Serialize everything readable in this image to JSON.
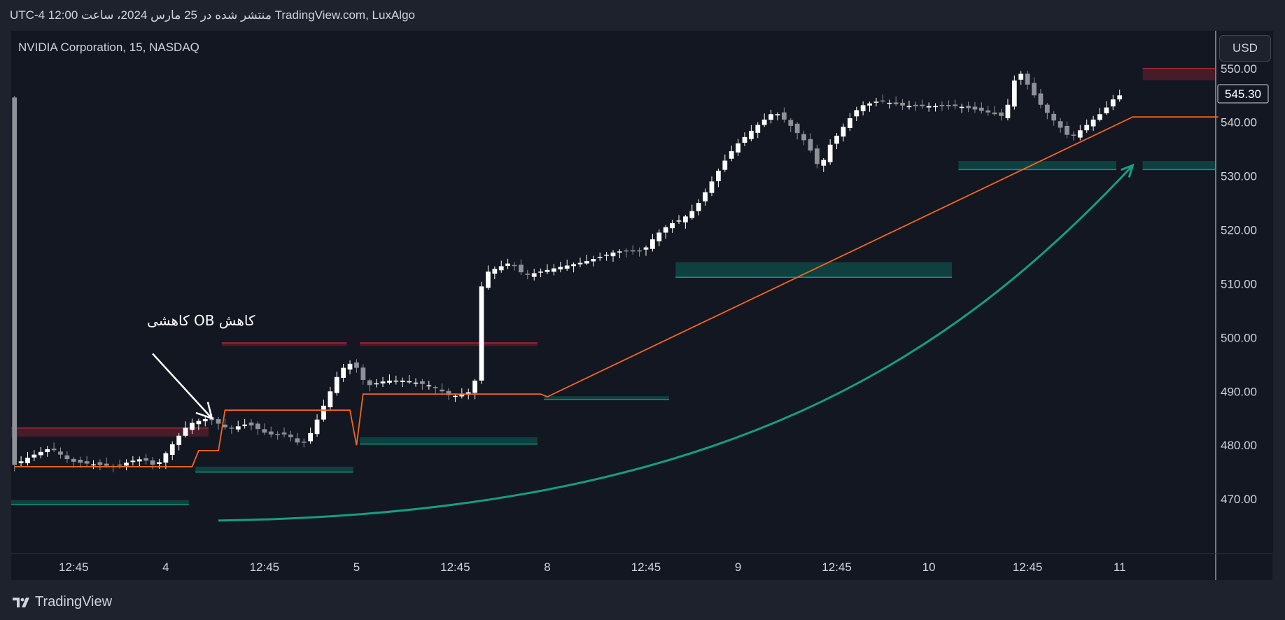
{
  "header": {
    "published_line": "UTC-4 12:00 منتشر شده در 25 مارس 2024، ساعت TradingView.com, LuxAlgo",
    "symbol_label": "NVIDIA Corporation, 15, NASDAQ",
    "currency_label": "USD"
  },
  "annotation": {
    "text": "کاهش OB کاهشی"
  },
  "brand": {
    "name": "TradingView",
    "logo_icon": "tradingview-logo-icon"
  },
  "colors": {
    "background": "#131722",
    "frame": "#1e222d",
    "bull_candle": "#ffffff",
    "bear_candle": "#8f9199",
    "bear_ob": "#b22833",
    "bull_ob": "#089981",
    "orange_line": "#f7651c",
    "arrow_white": "#ffffff",
    "curve_green": "#149e82"
  },
  "chart_data": {
    "type": "candlestick",
    "title": "NVIDIA Corporation, 15, NASDAQ",
    "ylim": [
      460,
      557
    ],
    "y_ticks": [
      "550.00",
      "540.00",
      "530.00",
      "520.00",
      "510.00",
      "500.00",
      "490.00",
      "480.00",
      "470.00"
    ],
    "y_tick_values": [
      550,
      540,
      530,
      520,
      510,
      500,
      490,
      480,
      470
    ],
    "last_price": "545.30",
    "last_price_value": 545.3,
    "x_ticks": [
      "12:45",
      "4",
      "12:45",
      "5",
      "12:45",
      "8",
      "12:45",
      "9",
      "12:45",
      "10",
      "12:45",
      "11"
    ],
    "x_tick_bars": [
      9,
      23,
      38,
      52,
      67,
      81,
      96,
      110,
      125,
      139,
      154,
      168
    ],
    "bars_total": 183,
    "pivots": [
      [
        0,
        476
      ],
      [
        3,
        478
      ],
      [
        6,
        479.5
      ],
      [
        9,
        477
      ],
      [
        12,
        476.5
      ],
      [
        16,
        476
      ],
      [
        18,
        477
      ],
      [
        20,
        477.5
      ],
      [
        22,
        476
      ],
      [
        25,
        481
      ],
      [
        27,
        484
      ],
      [
        30,
        485
      ],
      [
        33,
        483
      ],
      [
        36,
        484
      ],
      [
        39,
        482
      ],
      [
        42,
        482
      ],
      [
        44,
        480
      ],
      [
        45,
        481
      ],
      [
        47,
        486
      ],
      [
        50,
        494
      ],
      [
        52,
        495.5
      ],
      [
        54,
        491
      ],
      [
        57,
        492
      ],
      [
        60,
        492
      ],
      [
        64,
        491
      ],
      [
        67,
        489
      ],
      [
        70,
        490
      ],
      [
        70.5,
        492
      ],
      [
        71,
        507
      ],
      [
        72,
        512
      ],
      [
        76,
        514
      ],
      [
        78,
        511.5
      ],
      [
        83,
        513
      ],
      [
        87,
        514
      ],
      [
        92,
        516
      ],
      [
        96,
        516
      ],
      [
        98,
        519
      ],
      [
        100,
        521
      ],
      [
        102,
        522
      ],
      [
        104,
        524
      ],
      [
        106,
        528
      ],
      [
        108,
        532
      ],
      [
        110,
        535.5
      ],
      [
        113,
        539
      ],
      [
        116,
        542
      ],
      [
        118,
        540
      ],
      [
        121,
        536
      ],
      [
        123,
        531
      ],
      [
        124,
        535
      ],
      [
        127,
        540
      ],
      [
        129,
        543
      ],
      [
        132,
        544
      ],
      [
        136,
        543
      ],
      [
        140,
        543
      ],
      [
        144,
        543
      ],
      [
        148,
        542
      ],
      [
        151,
        541
      ],
      [
        153,
        550
      ],
      [
        156,
        544
      ],
      [
        158,
        541
      ],
      [
        161,
        537
      ],
      [
        164,
        540
      ],
      [
        166,
        542
      ],
      [
        168,
        545
      ]
    ],
    "order_blocks": [
      {
        "kind": "bearish",
        "from_bar": 0,
        "to_bar": 30,
        "top": 483.2,
        "bottom": 481.6
      },
      {
        "kind": "bearish",
        "from_bar": 32,
        "to_bar": 51,
        "top": 499.0,
        "bottom": 498.4
      },
      {
        "kind": "bearish",
        "from_bar": 53,
        "to_bar": 80,
        "top": 499.0,
        "bottom": 498.4
      },
      {
        "kind": "bearish",
        "from_bar": 172,
        "to_bar": 183,
        "top": 550.0,
        "bottom": 547.8
      },
      {
        "kind": "bullish",
        "from_bar": 0,
        "to_bar": 27,
        "top": 469.8,
        "bottom": 469.0
      },
      {
        "kind": "bullish",
        "from_bar": 28,
        "to_bar": 52,
        "top": 476.0,
        "bottom": 475.0
      },
      {
        "kind": "bullish",
        "from_bar": 53,
        "to_bar": 80,
        "top": 481.5,
        "bottom": 480.2
      },
      {
        "kind": "bullish",
        "from_bar": 81,
        "to_bar": 100,
        "top": 489.1,
        "bottom": 488.5
      },
      {
        "kind": "bullish",
        "from_bar": 101,
        "to_bar": 143,
        "top": 514.0,
        "bottom": 511.2
      },
      {
        "kind": "bullish",
        "from_bar": 144,
        "to_bar": 168,
        "top": 532.8,
        "bottom": 531.2
      },
      {
        "kind": "bullish",
        "from_bar": 172,
        "to_bar": 183,
        "top": 532.8,
        "bottom": 531.2
      }
    ],
    "orange_line": [
      [
        0,
        476
      ],
      [
        27,
        476
      ],
      [
        28,
        479
      ],
      [
        31,
        479
      ],
      [
        32,
        486.5
      ],
      [
        51,
        486.5
      ],
      [
        52,
        480
      ],
      [
        53,
        489.5
      ],
      [
        80,
        489.5
      ],
      [
        81,
        489
      ],
      [
        170,
        541
      ],
      [
        183,
        541
      ]
    ],
    "annotation_arrow": {
      "from_bar": 21,
      "from_price": 497,
      "to_bar": 30,
      "to_price": 485
    },
    "growth_curve": {
      "from_bar": 31,
      "from_price": 466,
      "to_bar": 170,
      "to_price": 532
    }
  }
}
